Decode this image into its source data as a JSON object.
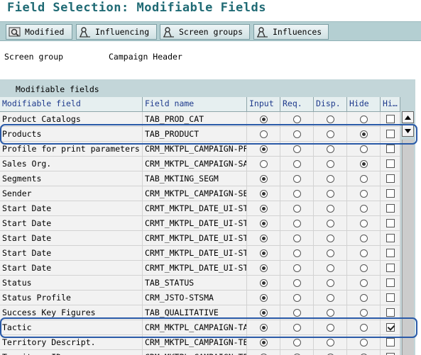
{
  "window": {
    "title": "Field Selection: Modifiable Fields"
  },
  "toolbar": {
    "buttons": [
      {
        "label": "Modified",
        "icon": "modified-icon"
      },
      {
        "label": "Influencing",
        "icon": "influencing-icon"
      },
      {
        "label": "Screen groups",
        "icon": "screen-groups-icon"
      },
      {
        "label": "Influences",
        "icon": "influences-icon"
      }
    ]
  },
  "info": {
    "label": "Screen group",
    "value": "Campaign Header"
  },
  "panel": {
    "title": "Modifiable fields"
  },
  "table": {
    "columns": [
      "Modifiable field",
      "Field name",
      "Input",
      "Req.",
      "Disp.",
      "Hide",
      "Hi…"
    ],
    "rows": [
      {
        "field": "Product Catalogs",
        "name": "TAB_PROD_CAT",
        "sel": "input",
        "check": false,
        "highlight": false
      },
      {
        "field": "Products",
        "name": "TAB_PRODUCT",
        "sel": "hide",
        "check": false,
        "highlight": true
      },
      {
        "field": "Profile for print parameters",
        "name": "CRM_MKTPL_CAMPAIGN-PF",
        "sel": "input",
        "check": false,
        "highlight": false
      },
      {
        "field": "Sales Org.",
        "name": "CRM_MKTPL_CAMPAIGN-SA",
        "sel": "hide",
        "check": false,
        "highlight": false
      },
      {
        "field": "Segments",
        "name": "TAB_MKTING_SEGM",
        "sel": "input",
        "check": false,
        "highlight": false
      },
      {
        "field": "Sender",
        "name": "CRM_MKTPL_CAMPAIGN-SE",
        "sel": "input",
        "check": false,
        "highlight": false
      },
      {
        "field": "Start Date",
        "name": "CRMT_MKTPL_DATE_UI-ST",
        "sel": "input",
        "check": false,
        "highlight": false
      },
      {
        "field": "Start Date",
        "name": "CRMT_MKTPL_DATE_UI-ST",
        "sel": "input",
        "check": false,
        "highlight": false
      },
      {
        "field": "Start Date",
        "name": "CRMT_MKTPL_DATE_UI-ST",
        "sel": "input",
        "check": false,
        "highlight": false
      },
      {
        "field": "Start Date",
        "name": "CRMT_MKTPL_DATE_UI-ST",
        "sel": "input",
        "check": false,
        "highlight": false
      },
      {
        "field": "Start Date",
        "name": "CRMT_MKTPL_DATE_UI-ST",
        "sel": "input",
        "check": false,
        "highlight": false
      },
      {
        "field": "Status",
        "name": "TAB_STATUS",
        "sel": "input",
        "check": false,
        "highlight": false
      },
      {
        "field": "Status Profile",
        "name": "CRM_JSTO-STSMA",
        "sel": "input",
        "check": false,
        "highlight": false
      },
      {
        "field": "Success Key Figures",
        "name": "TAB_QUALITATIVE",
        "sel": "input",
        "check": false,
        "highlight": false
      },
      {
        "field": "Tactic",
        "name": "CRM_MKTPL_CAMPAIGN-TA",
        "sel": "input",
        "check": true,
        "highlight": true
      },
      {
        "field": "Territory Descript.",
        "name": "CRM_MKTPL_CAMPAIGN-TE",
        "sel": "input",
        "check": false,
        "highlight": false
      },
      {
        "field": "Territory ID",
        "name": "CRM_MKTPL_CAMPAIGN-TE",
        "sel": "input",
        "check": false,
        "highlight": false
      }
    ]
  },
  "colors": {
    "title": "#1f6a74",
    "header_text": "#1e3a8c",
    "toolbar": "#b4cfd2",
    "panel": "#c3d6d9",
    "highlight": "#2a5aa8"
  }
}
